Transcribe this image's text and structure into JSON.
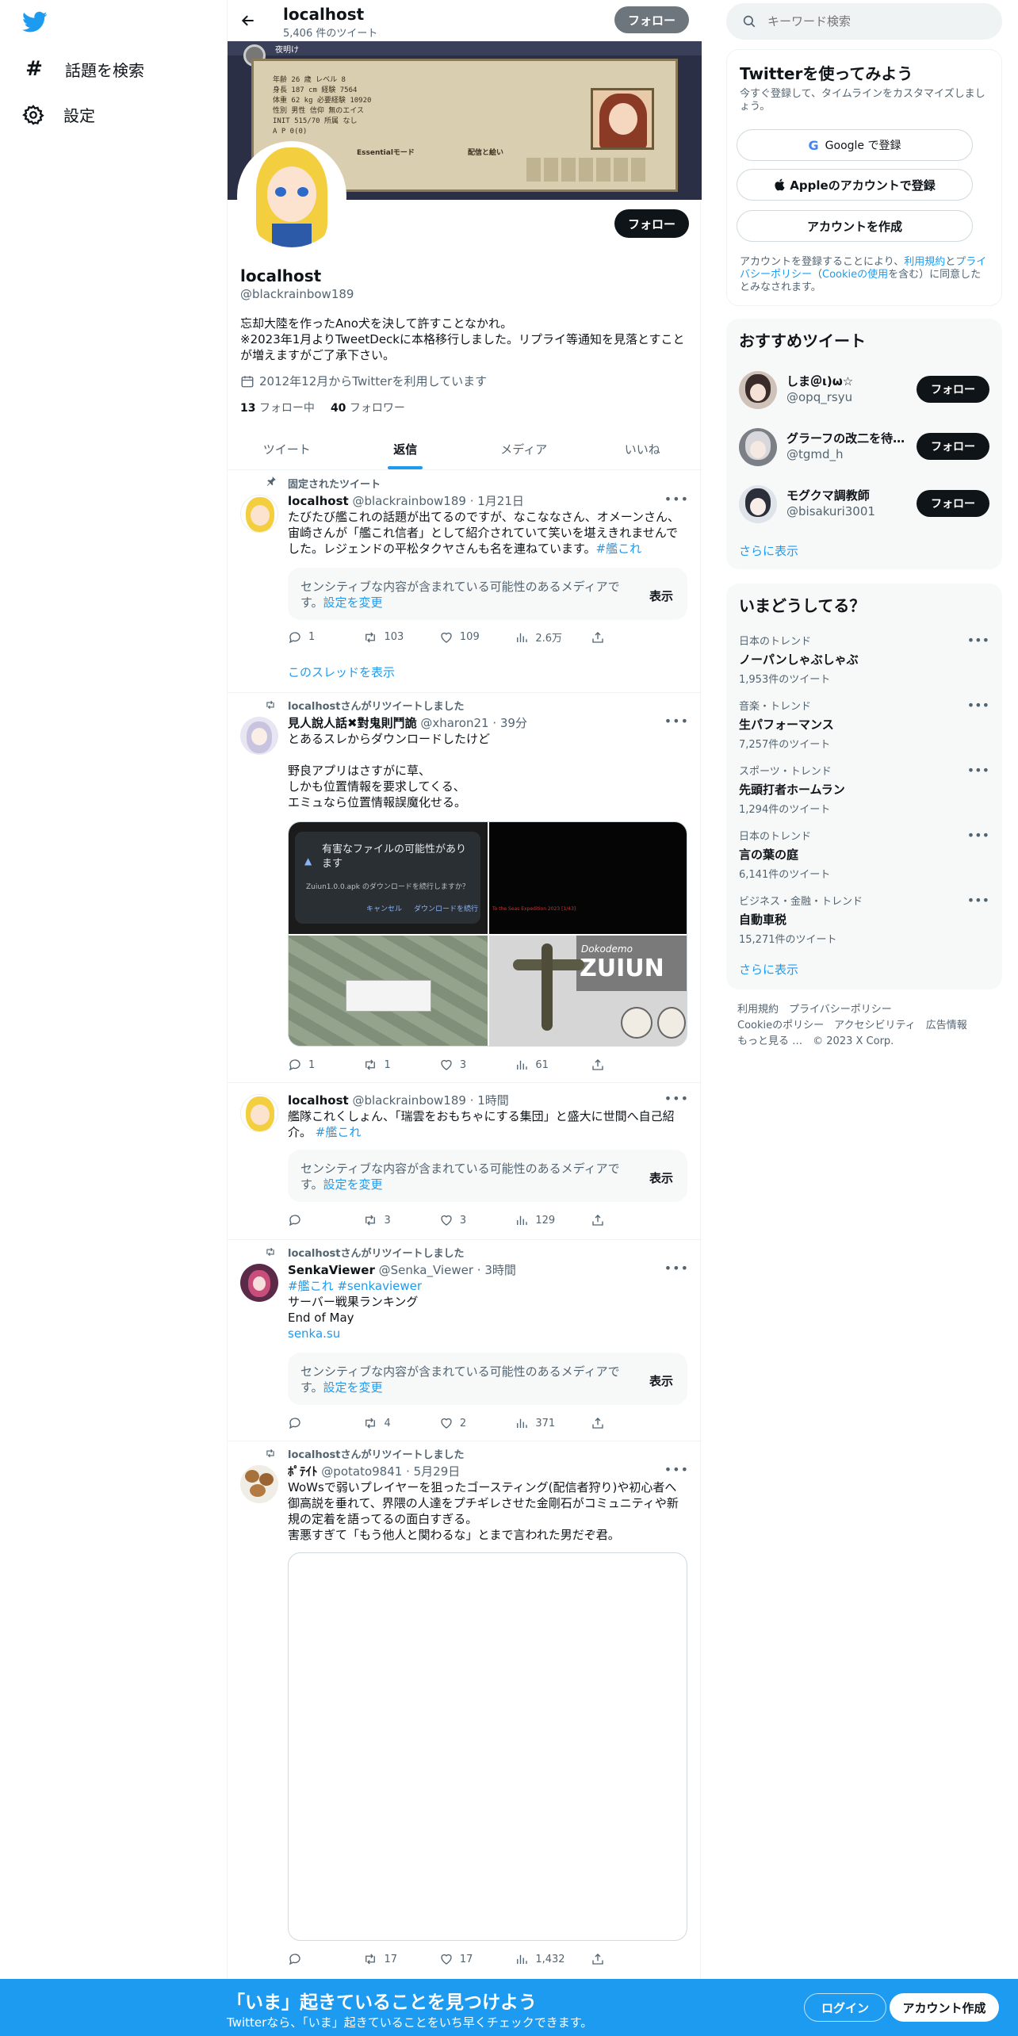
{
  "colors": {
    "accent": "#1d9bf0",
    "text": "#0f1419",
    "muted": "#536471",
    "border": "#eff3f4",
    "card": "#f7f9f9"
  },
  "nav": {
    "explore": "話題を検索",
    "settings": "設定"
  },
  "header": {
    "name": "localhost",
    "tweet_count": "5,406 件のツイート",
    "follow": "フォロー"
  },
  "profile": {
    "name": "localhost",
    "handle": "@blackrainbow189",
    "bio1": "忘却大陸を作ったAno犬を決して許すことなかれ。",
    "bio2": "※2023年1月よりTweetDeckに本格移行しました。リプライ等通知を見落とすことが増えますがご了承下さい。",
    "joined": "2012年12月からTwitterを利用しています",
    "following_count": "13",
    "following_label": "フォロー中",
    "followers_count": "40",
    "followers_label": "フォロワー",
    "follow": "フォロー",
    "banner": {
      "line1": "夜明け",
      "r1": "年齢 26 歳   レベル 8",
      "r2": "身長 187 cm  経験 7564",
      "r3": "体重 62 kg   必要経験 10920",
      "r4": "性別 男性    信仰 無のエイス",
      "r5": "INIT 515/70  所属 なし",
      "r6": "A P  0(0)",
      "tag1": "Essentialモード",
      "tag2": "配信と絵い"
    }
  },
  "tabs": [
    "ツイート",
    "返信",
    "メディア",
    "いいね"
  ],
  "pinned_label": "固定されたツイート",
  "tweets": [
    {
      "name": "localhost",
      "handle": "@blackrainbow189",
      "time": "1月21日",
      "text": "たびたび艦これの話題が出てるのですが、なこななさん、オメーンさん、宙崎さんが「艦これ信者」として紹介されていて笑いを堪えきれませんでした。レジェンドの平松タクヤさんも名を連ねています。",
      "hashtag": "#艦これ",
      "sensitive": "センシティブな内容が含まれている可能性のあるメディアです。",
      "settings_link": "設定を変更",
      "show": "表示",
      "replies": "1",
      "retweets": "103",
      "likes": "109",
      "views": "2.6万",
      "thread": "このスレッドを表示"
    },
    {
      "rt": "localhostさんがリツイートしました",
      "name": "見人說人話✖對鬼則鬥詭",
      "handle": "@xharon21",
      "time": "39分",
      "line1": "とあるスレからダウンロードしたけど",
      "line2": "野良アプリはさすがに草、",
      "line3": "しかも位置情報を要求してくる、",
      "line4": "エミュなら位置情報誤魔化せる。",
      "dlg_title": "有害なファイルの可能性があります",
      "dlg_body": "Zuiun1.0.0.apk のダウンロードを続行しますか？",
      "dlg_cancel": "キャンセル",
      "dlg_ok": "ダウンロードを続行",
      "img2_text": "To the Seas Expedition 2023 [1/43]",
      "img4_small": "Dokodemo",
      "img4_big": "ZUIUN",
      "replies": "1",
      "retweets": "1",
      "likes": "3",
      "views": "61"
    },
    {
      "name": "localhost",
      "handle": "@blackrainbow189",
      "time": "1時間",
      "text": "艦隊これくしょん、「瑞雲をおもちゃにする集団」と盛大に世間へ自己紹介。",
      "hashtag": "#艦これ",
      "sensitive": "センシティブな内容が含まれている可能性のあるメディアです。",
      "settings_link": "設定を変更",
      "show": "表示",
      "replies": "",
      "retweets": "3",
      "likes": "3",
      "views": "129"
    },
    {
      "rt": "localhostさんがリツイートしました",
      "name": "SenkaViewer",
      "handle": "@Senka_Viewer",
      "time": "3時間",
      "hashtags": "#艦これ #senkaviewer",
      "line1": "サーバー戦果ランキング",
      "line2": "End of May",
      "link": "senka.su",
      "sensitive": "センシティブな内容が含まれている可能性のあるメディアです。",
      "settings_link": "設定を変更",
      "show": "表示",
      "replies": "",
      "retweets": "4",
      "likes": "2",
      "views": "371"
    },
    {
      "rt": "localhostさんがリツイートしました",
      "name": "ﾎﾟﾃｲﾄ",
      "handle": "@potato9841",
      "time": "5月29日",
      "text": "WoWsで弱いプレイヤーを狙ったゴースティング(配信者狩り)や初心者へ御高説を垂れて、界隈の人達をプチギレさせた金剛石がコミュニティや新規の定着を語ってるの面白すぎる。",
      "text2": "害悪すぎて「もう他人と関わるな」とまで言われた男だぞ君。",
      "replies": "",
      "retweets": "17",
      "likes": "17",
      "views": "1,432"
    }
  ],
  "search": {
    "placeholder": "キーワード検索"
  },
  "signup": {
    "title": "Twitterを使ってみよう",
    "subtitle": "今すぐ登録して、タイムラインをカスタマイズしましょう。",
    "google": "Google で登録",
    "apple": "Appleのアカウントで登録",
    "create": "アカウントを作成",
    "legal_a": "アカウントを登録することにより、",
    "legal_terms": "利用規約",
    "legal_b": "と",
    "legal_privacy": "プライバシーポリシー",
    "legal_c": "（",
    "legal_cookie": "Cookieの使用",
    "legal_d": "を含む）に同意したとみなされます。"
  },
  "recommend": {
    "title": "おすすめツイート",
    "follow": "フォロー",
    "more": "さらに表示",
    "users": [
      {
        "name": "しま＠ι)ω☆",
        "handle": "@opq_rsyu"
      },
      {
        "name": "グラーフの改二を待…",
        "handle": "@tgmd_h"
      },
      {
        "name": "モグクマ調教師",
        "handle": "@bisakuri3001"
      }
    ]
  },
  "trends": {
    "title": "いまどうしてる？",
    "more": "さらに表示",
    "items": [
      {
        "cat": "日本のトレンド",
        "name": "ノーパンしゃぶしゃぶ",
        "count": "1,953件のツイート"
      },
      {
        "cat": "音楽・トレンド",
        "name": "生パフォーマンス",
        "count": "7,257件のツイート"
      },
      {
        "cat": "スポーツ・トレンド",
        "name": "先頭打者ホームラン",
        "count": "1,294件のツイート"
      },
      {
        "cat": "日本のトレンド",
        "name": "言の葉の庭",
        "count": "6,141件のツイート"
      },
      {
        "cat": "ビジネス・金融・トレンド",
        "name": "自動車税",
        "count": "15,271件のツイート"
      }
    ]
  },
  "footer": {
    "terms": "利用規約",
    "privacy": "プライバシーポリシー",
    "cookie": "Cookieのポリシー",
    "access": "アクセシビリティ",
    "ads": "広告情報",
    "more": "もっと見る …",
    "copy": "© 2023 X Corp."
  },
  "bottombar": {
    "title": "「いま」起きていることを見つけよう",
    "subtitle": "Twitterなら、「いま」起きていることをいち早くチェックできます。",
    "login": "ログイン",
    "signup": "アカウント作成"
  }
}
